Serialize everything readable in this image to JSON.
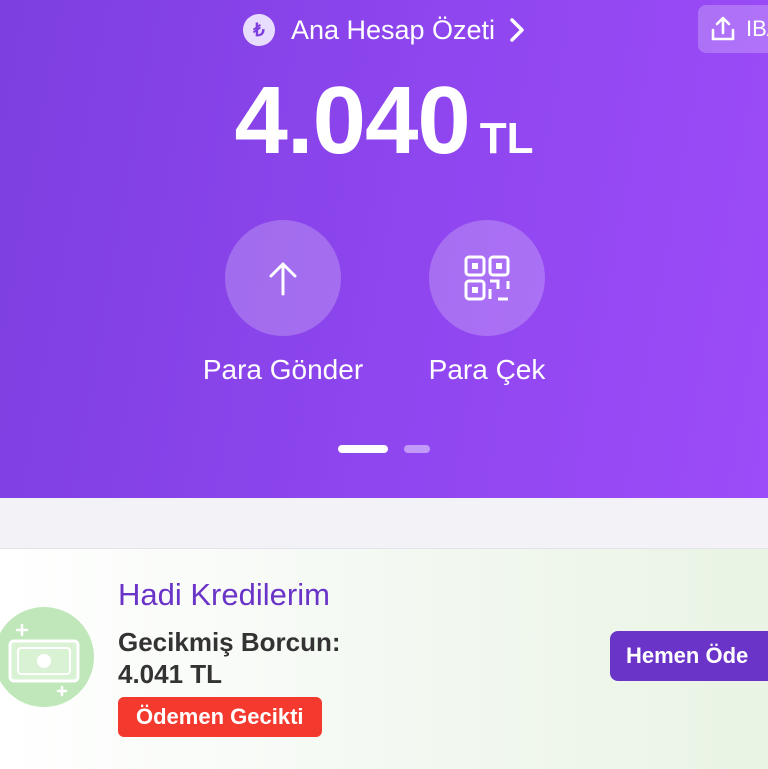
{
  "header": {
    "currency_symbol": "₺",
    "title": "Ana Hesap Özeti",
    "iban_label": "IBAN"
  },
  "balance": {
    "amount": "4.040",
    "currency": "TL"
  },
  "actions": [
    {
      "label": "Para Gönder",
      "icon": "arrow-up-icon"
    },
    {
      "label": "Para Çek",
      "icon": "qr-code-icon"
    }
  ],
  "pagination": {
    "pages": 2,
    "active": 1
  },
  "loan_card": {
    "title": "Hadi Kredilerim",
    "debt_label": "Gecikmiş Borcun:",
    "debt_amount": "4.041 TL",
    "status_badge": "Ödemen Gecikti",
    "pay_button": "Hemen Öde",
    "icon": "money-icon"
  },
  "colors": {
    "primary_purple": "#8f46ef",
    "accent_purple": "#6a34c8",
    "late_red": "#f43a2f",
    "money_green": "#bfe7b9"
  }
}
